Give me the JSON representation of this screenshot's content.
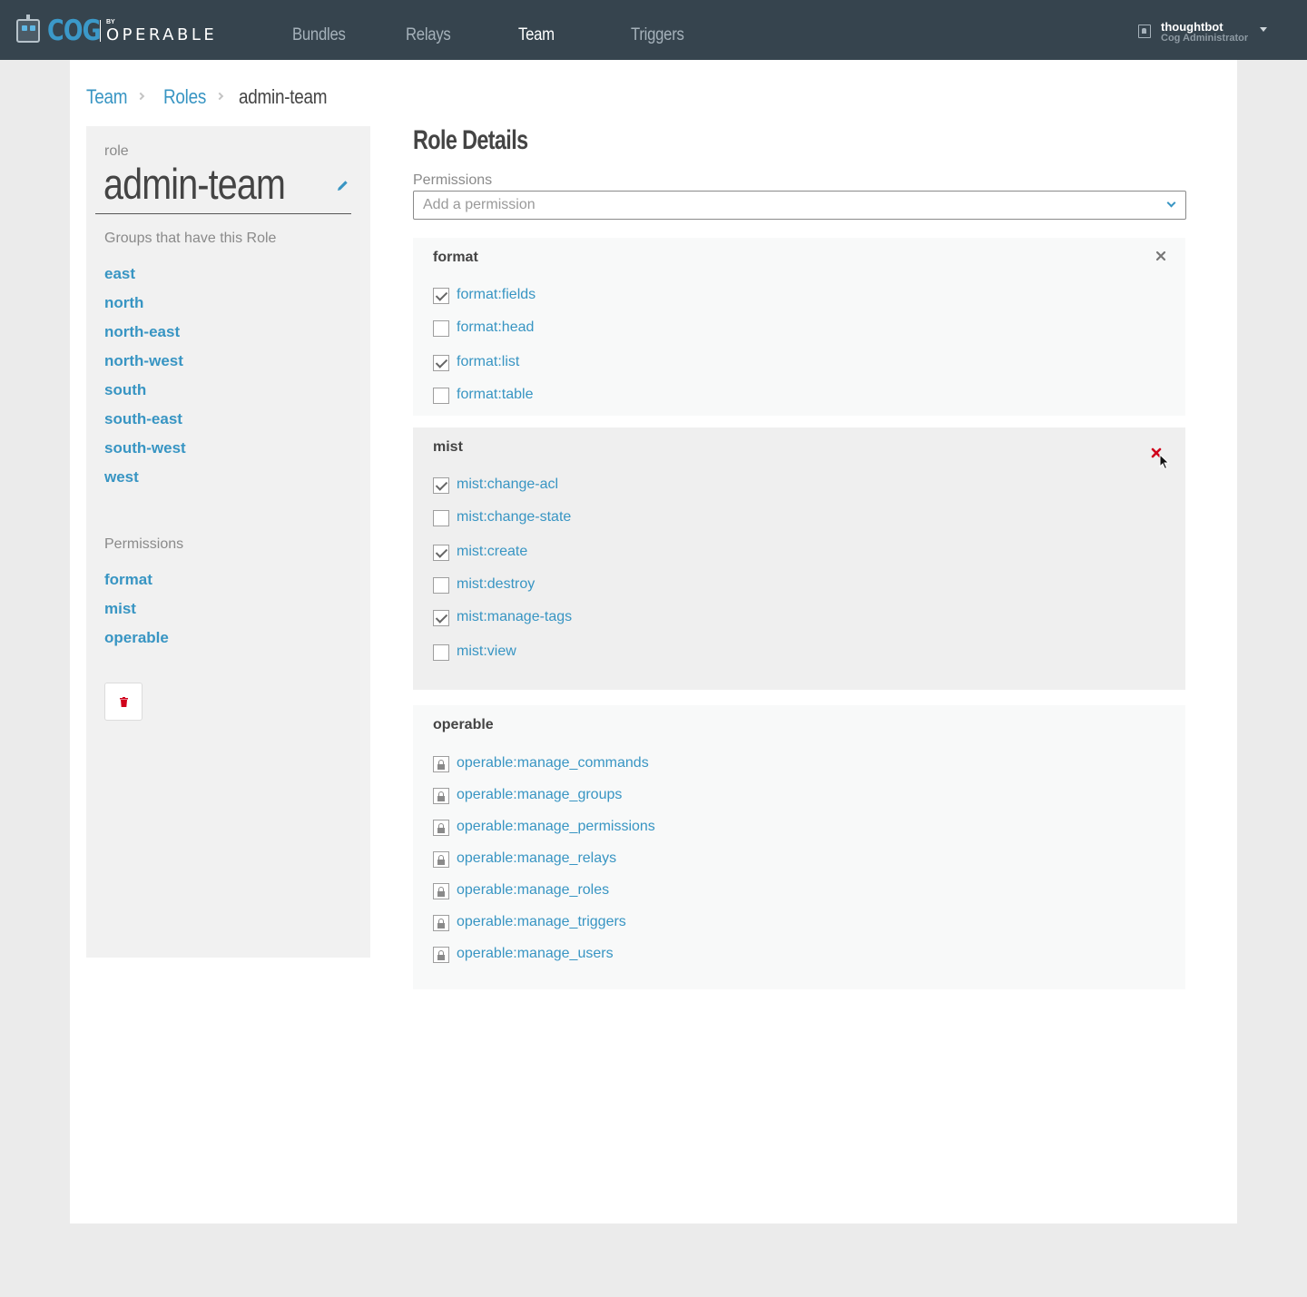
{
  "brand": {
    "name": "COG",
    "by": "BY",
    "company": "OPERABLE"
  },
  "nav": [
    {
      "label": "Bundles",
      "active": false
    },
    {
      "label": "Relays",
      "active": false
    },
    {
      "label": "Team",
      "active": true
    },
    {
      "label": "Triggers",
      "active": false
    }
  ],
  "user": {
    "name": "thoughtbot",
    "role": "Cog Administrator"
  },
  "breadcrumb": [
    {
      "label": "Team",
      "link": true
    },
    {
      "label": "Roles",
      "link": true
    },
    {
      "label": "admin-team",
      "link": false
    }
  ],
  "sidebar": {
    "role_label": "role",
    "role_name": "admin-team",
    "groups_heading": "Groups that have this Role",
    "groups": [
      "east",
      "north",
      "north-east",
      "north-west",
      "south",
      "south-east",
      "south-west",
      "west"
    ],
    "permissions_heading": "Permissions",
    "permissions": [
      "format",
      "mist",
      "operable"
    ]
  },
  "main": {
    "title": "Role Details",
    "permissions_label": "Permissions",
    "permissions_placeholder": "Add a permission"
  },
  "bundles": [
    {
      "name": "format",
      "locked": false,
      "items": [
        {
          "label": "format:fields",
          "checked": true
        },
        {
          "label": "format:head",
          "checked": false
        },
        {
          "label": "format:list",
          "checked": true
        },
        {
          "label": "format:table",
          "checked": false
        }
      ]
    },
    {
      "name": "mist",
      "locked": false,
      "items": [
        {
          "label": "mist:change-acl",
          "checked": true
        },
        {
          "label": "mist:change-state",
          "checked": false
        },
        {
          "label": "mist:create",
          "checked": true
        },
        {
          "label": "mist:destroy",
          "checked": false
        },
        {
          "label": "mist:manage-tags",
          "checked": true
        },
        {
          "label": "mist:view",
          "checked": false
        }
      ]
    },
    {
      "name": "operable",
      "locked": true,
      "items": [
        {
          "label": "operable:manage_commands"
        },
        {
          "label": "operable:manage_groups"
        },
        {
          "label": "operable:manage_permissions"
        },
        {
          "label": "operable:manage_relays"
        },
        {
          "label": "operable:manage_roles"
        },
        {
          "label": "operable:manage_triggers"
        },
        {
          "label": "operable:manage_users"
        }
      ]
    }
  ],
  "colors": {
    "nav_bg": "#36444e",
    "link": "#3895c3",
    "close_hover": "#d0021b",
    "panel_bg": "#f1f1f1",
    "bundle_bg": "#f8f9f9",
    "bundle_hover_bg": "#efefef"
  }
}
